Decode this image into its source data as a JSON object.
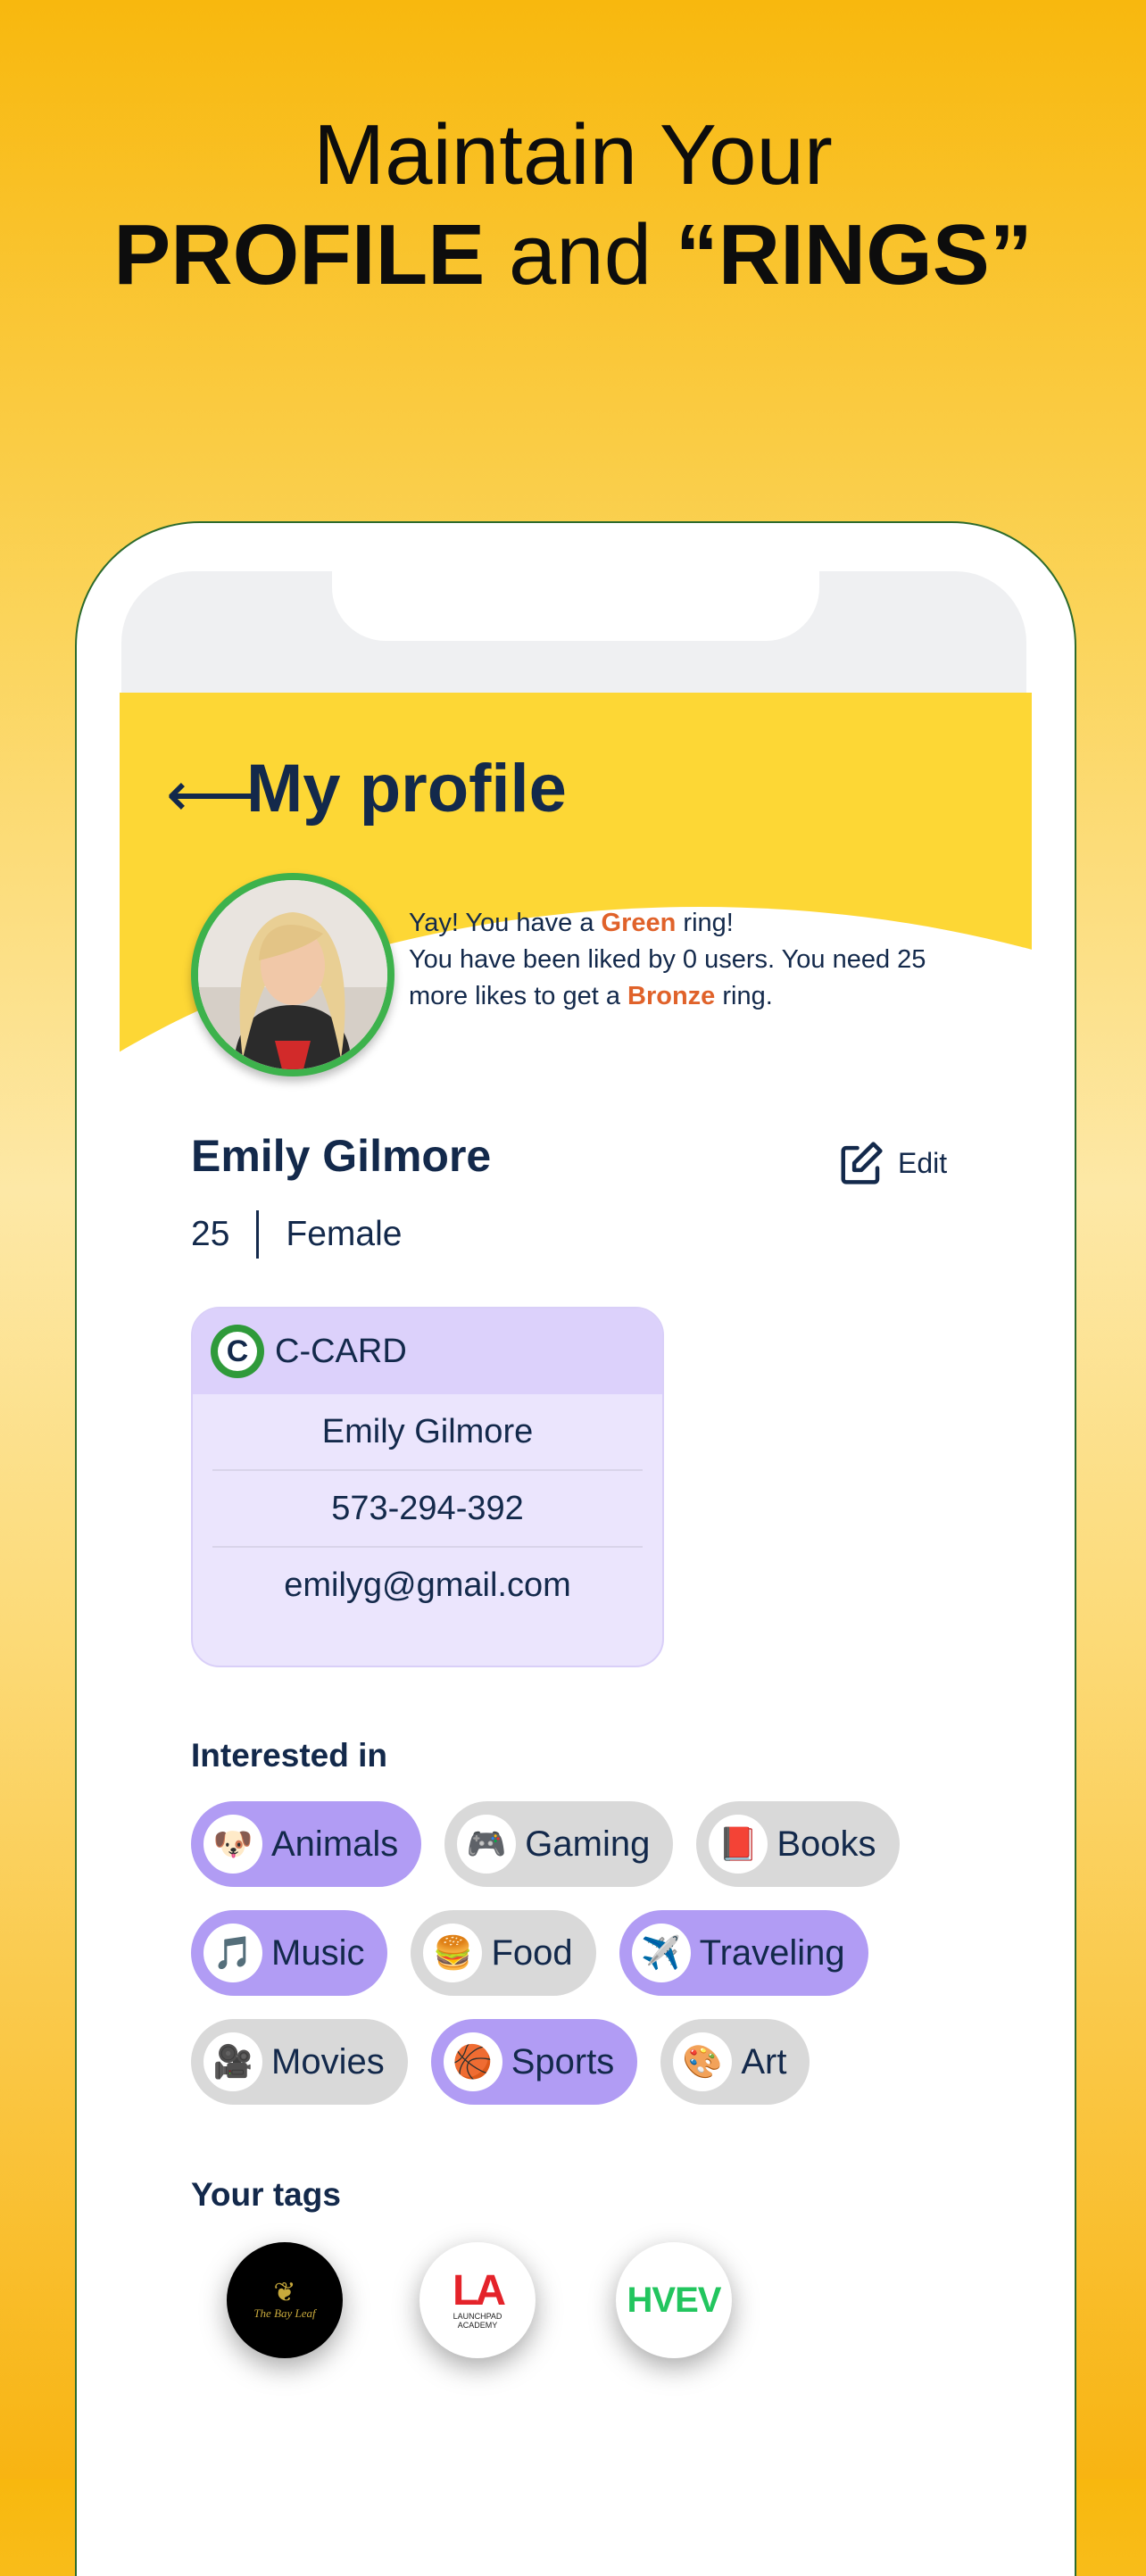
{
  "headline": {
    "line1": "Maintain Your",
    "line2_bold1": "PROFILE",
    "line2_mid": " and ",
    "line2_bold2": "“RINGS”"
  },
  "header": {
    "back_icon": "arrow-left-icon",
    "title": "My profile"
  },
  "ring_message": {
    "p1": "Yay! You have a ",
    "ring_current": "Green",
    "p2": " ring!",
    "p3": "You have been liked by 0 users. You need 25 more likes to get a ",
    "ring_next": "Bronze",
    "p4": " ring."
  },
  "profile": {
    "name": "Emily Gilmore",
    "age": "25",
    "gender": "Female",
    "edit_label": "Edit"
  },
  "ccard": {
    "title": "C-CARD",
    "logo_letter": "C",
    "name": "Emily Gilmore",
    "phone": "573-294-392",
    "email": "emilyg@gmail.com"
  },
  "interests": {
    "label": "Interested in",
    "items": [
      {
        "label": "Animals",
        "icon": "🐶",
        "selected": true
      },
      {
        "label": "Gaming",
        "icon": "🎮",
        "selected": false
      },
      {
        "label": "Books",
        "icon": "📕",
        "selected": false
      },
      {
        "label": "Music",
        "icon": "🎵",
        "selected": true
      },
      {
        "label": "Food",
        "icon": "🍔",
        "selected": false
      },
      {
        "label": "Traveling",
        "icon": "✈️",
        "selected": true
      },
      {
        "label": "Movies",
        "icon": "🎥",
        "selected": false
      },
      {
        "label": "Sports",
        "icon": "🏀",
        "selected": true
      },
      {
        "label": "Art",
        "icon": "🎨",
        "selected": false
      }
    ]
  },
  "tags": {
    "label": "Your tags",
    "items": [
      {
        "text": "The Bay Leaf"
      },
      {
        "logo": "LA",
        "text": "LAUNCHPAD ACADEMY"
      },
      {
        "logo": "HVEV"
      }
    ]
  },
  "colors": {
    "ring_green": "#3db24c",
    "accent_orange": "#e0622a",
    "navy": "#13294b",
    "chip_selected": "#b19cf4",
    "header_yellow": "#fdd735"
  }
}
